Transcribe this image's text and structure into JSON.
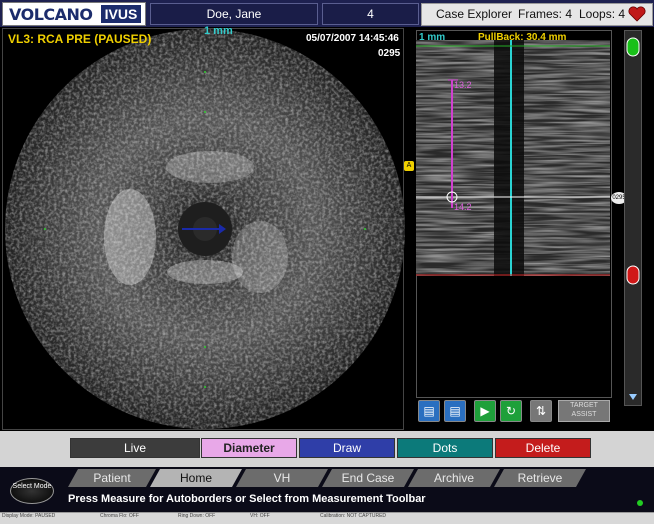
{
  "header": {
    "logo_volcano": "VOLCANO",
    "logo_ivus": "IVUS",
    "patient_name": "Doe, Jane",
    "case_number": "4",
    "case_explorer_label": "Case Explorer",
    "frames_label": "Frames: 4",
    "loops_label": "Loops: 4",
    "heart_icon": "heart-icon"
  },
  "ivus": {
    "title": "VL3: RCA PRE (PAUSED)",
    "scale_label": "1 mm",
    "datetime": "05/07/2007 14:45:46",
    "frame_number": "0295",
    "arrow_color": "#1a2aa8"
  },
  "longitudinal": {
    "scale_label": "1 mm",
    "pullback_label": "PullBack: 30.4 mm",
    "meas_top": "13.2",
    "meas_bottom": "14.2",
    "right_marker": "0295",
    "left_marker": "A"
  },
  "lbuttons": [
    "frame-left-icon",
    "frame-right-icon",
    "play-icon",
    "loop-icon",
    "split-icon"
  ],
  "target_assist": "TARGET ASSIST",
  "tools": {
    "live": "Live",
    "diameter": "Diameter",
    "draw": "Draw",
    "dots": "Dots",
    "delete": "Delete"
  },
  "nav": {
    "patient": "Patient",
    "home": "Home",
    "vh": "VH",
    "end_case": "End Case",
    "archive": "Archive",
    "retrieve": "Retrieve"
  },
  "select_mode": "Select Mode",
  "status_message": "Press Measure for Autoborders or Select from Measurement Toolbar",
  "statusbar": [
    "Display Mode: PAUSED",
    "Chroma Flo: OFF",
    "Ring Down: OFF",
    "VH: OFF",
    "Calibration: NOT CAPTURED"
  ],
  "colors": {
    "header": "#1e2150",
    "diameter": "#e8a8e8",
    "draw": "#2f3ea8",
    "dots": "#0c7a7a",
    "delete": "#c41c1c"
  }
}
